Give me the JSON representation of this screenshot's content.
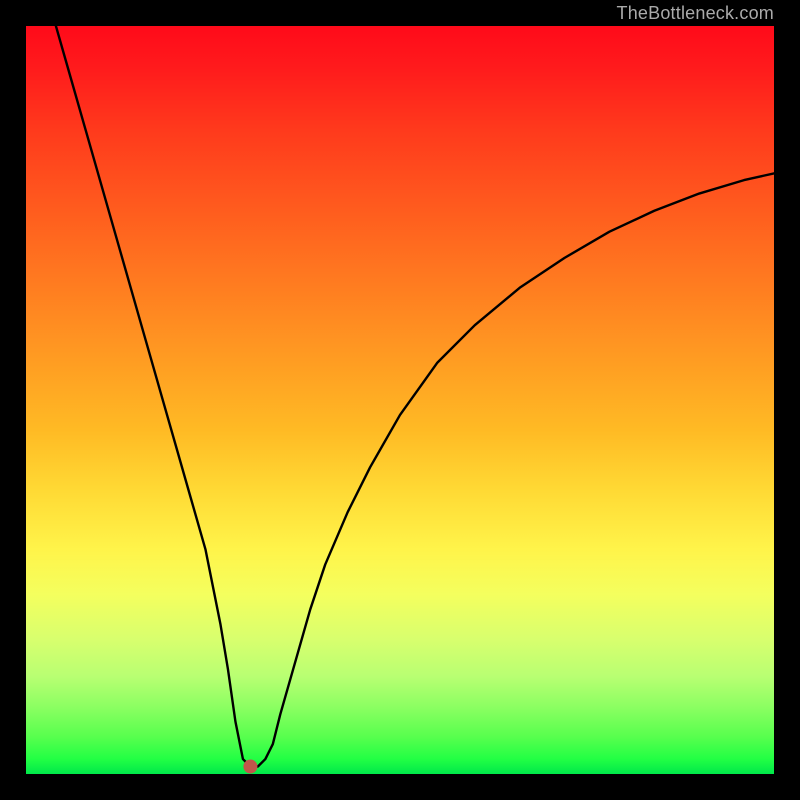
{
  "watermark": "TheBottleneck.com",
  "colors": {
    "background": "#000000",
    "gradient_top": "#ff0a1a",
    "gradient_bottom": "#00e84a",
    "curve": "#000000",
    "marker": "#c1564a",
    "watermark": "#aaaaaa"
  },
  "chart_data": {
    "type": "line",
    "title": "",
    "xlabel": "",
    "ylabel": "",
    "xlim": [
      0,
      100
    ],
    "ylim": [
      0,
      100
    ],
    "grid": false,
    "legend": false,
    "x": [
      4,
      6,
      8,
      10,
      12,
      14,
      16,
      18,
      20,
      22,
      24,
      26,
      27,
      28,
      29,
      30,
      31,
      32,
      33,
      34,
      36,
      38,
      40,
      43,
      46,
      50,
      55,
      60,
      66,
      72,
      78,
      84,
      90,
      96,
      100
    ],
    "y": [
      100,
      93,
      86,
      79,
      72,
      65,
      58,
      51,
      44,
      37,
      30,
      20,
      14,
      7,
      2,
      1,
      1,
      2,
      4,
      8,
      15,
      22,
      28,
      35,
      41,
      48,
      55,
      60,
      65,
      69,
      72.5,
      75.3,
      77.6,
      79.4,
      80.3
    ],
    "marker_point": {
      "x": 30,
      "y": 1
    },
    "note": "Curve shows a sharp V-shaped dip near x≈30, rises toward both sides; left branch is steep/linear, right branch is concave and flattens toward ~80% at the right edge."
  }
}
